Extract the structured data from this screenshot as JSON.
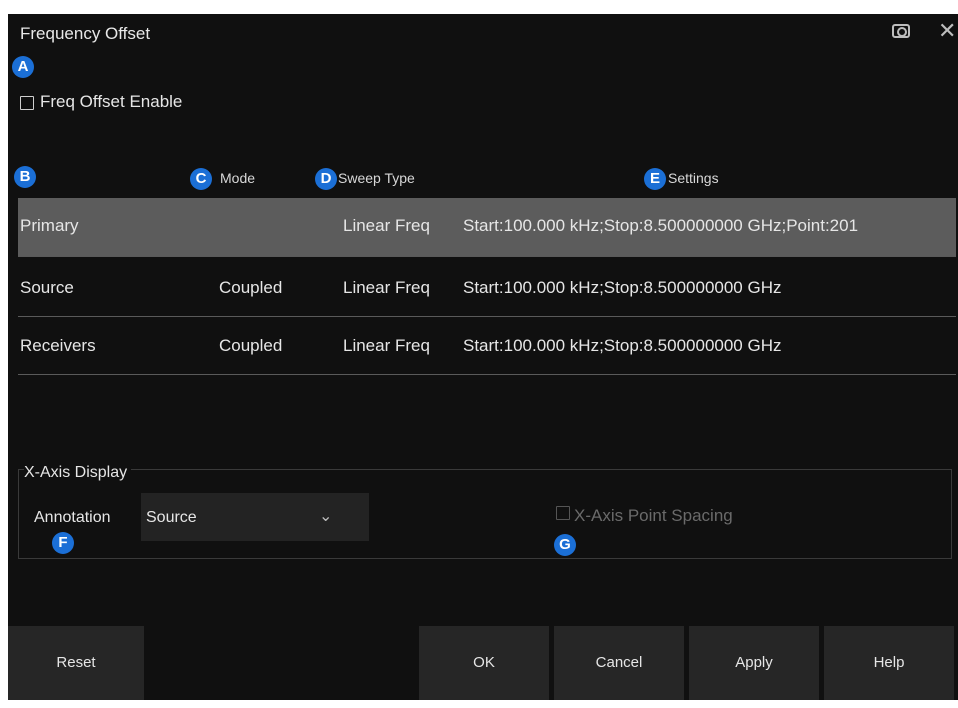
{
  "dialog": {
    "title": "Frequency Offset",
    "icons": {
      "snapshot": "camera-icon",
      "close": "close-icon"
    }
  },
  "badges": {
    "a": "A",
    "b": "B",
    "c": "C",
    "d": "D",
    "e": "E",
    "f": "F",
    "g": "G"
  },
  "freq_offset_enable": {
    "label": "Freq Offset Enable",
    "checked": false
  },
  "table": {
    "headers": {
      "mode": "Mode",
      "sweep_type": "Sweep Type",
      "settings": "Settings"
    },
    "rows": [
      {
        "name": "Primary",
        "mode": "",
        "sweep_type": "Linear Freq",
        "settings": "Start:100.000 kHz;Stop:8.500000000 GHz;Point:201",
        "selected": true
      },
      {
        "name": "Source",
        "mode": "Coupled",
        "sweep_type": "Linear Freq",
        "settings": "Start:100.000 kHz;Stop:8.500000000 GHz",
        "selected": false
      },
      {
        "name": "Receivers",
        "mode": "Coupled",
        "sweep_type": "Linear Freq",
        "settings": "Start:100.000 kHz;Stop:8.500000000 GHz",
        "selected": false
      }
    ]
  },
  "x_axis_display": {
    "group_title": "X-Axis Display",
    "annotation_label": "Annotation",
    "annotation_value": "Source",
    "point_spacing_label": "X-Axis Point Spacing",
    "point_spacing_enabled": false
  },
  "buttons": {
    "reset": "Reset",
    "ok": "OK",
    "cancel": "Cancel",
    "apply": "Apply",
    "help": "Help"
  },
  "colors": {
    "badge": "#1b6fd6",
    "background": "#101010",
    "selected_row": "#5c5c5c",
    "button": "#262626"
  }
}
